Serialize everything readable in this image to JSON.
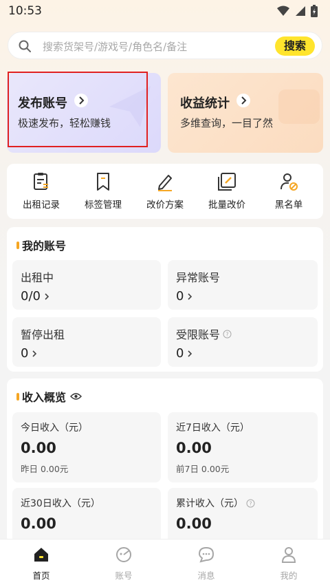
{
  "status": {
    "time": "10:53"
  },
  "search": {
    "placeholder": "搜索货架号/游戏号/角色名/备注",
    "button": "搜索"
  },
  "cards": {
    "publish": {
      "title": "发布账号",
      "subtitle": "极速发布，轻松赚钱"
    },
    "income": {
      "title": "收益统计",
      "subtitle": "多维查询，一目了然"
    }
  },
  "quick": [
    {
      "label": "出租记录",
      "icon": "rental-record-icon"
    },
    {
      "label": "标签管理",
      "icon": "tag-icon"
    },
    {
      "label": "改价方案",
      "icon": "pen-icon"
    },
    {
      "label": "批量改价",
      "icon": "batch-edit-icon"
    },
    {
      "label": "黑名单",
      "icon": "user-block-icon"
    }
  ],
  "accounts": {
    "title": "我的账号",
    "renting": {
      "label": "出租中",
      "value": "0/0"
    },
    "abnormal": {
      "label": "异常账号",
      "value": "0"
    },
    "paused": {
      "label": "暂停出租",
      "value": "0"
    },
    "restricted": {
      "label": "受限账号",
      "value": "0"
    }
  },
  "income": {
    "title": "收入概览",
    "today": {
      "label": "今日收入（元）",
      "value": "0.00",
      "sub": "昨日 0.00元"
    },
    "week": {
      "label": "近7日收入（元）",
      "value": "0.00",
      "sub": "前7日 0.00元"
    },
    "month": {
      "label": "近30日收入（元）",
      "value": "0.00"
    },
    "total": {
      "label": "累计收入（元）",
      "value": "0.00"
    }
  },
  "tabs": [
    {
      "label": "首页",
      "active": true
    },
    {
      "label": "账号"
    },
    {
      "label": "消息"
    },
    {
      "label": "我的"
    }
  ],
  "colors": {
    "accent": "#ffe42d",
    "orange": "#f5a623",
    "highlight": "#e02020"
  }
}
